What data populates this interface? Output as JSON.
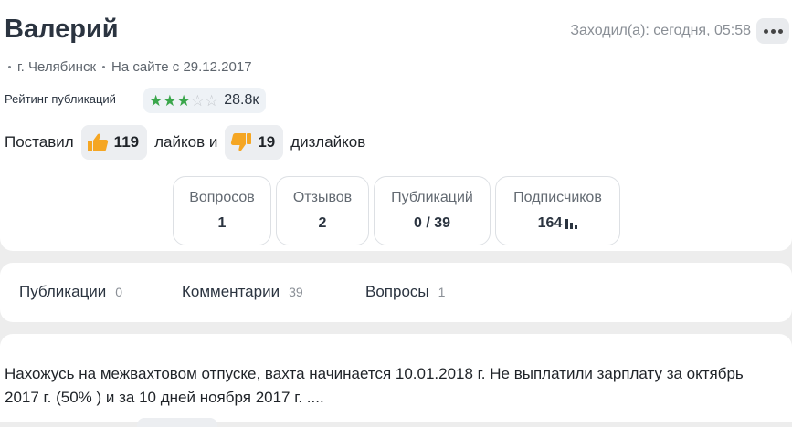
{
  "profile": {
    "name": "Валерий",
    "last_seen": "Заходил(а): сегодня, 05:58",
    "city": "г. Челябинск",
    "member_since": "На сайте с 29.12.2017"
  },
  "rating": {
    "label": "Рейтинг публикаций",
    "stars_filled": 3,
    "stars_total": 5,
    "value": "28.8к",
    "star_color": "#3aa64b"
  },
  "likes": {
    "prefix": "Поставил",
    "likes_count": "119",
    "middle": "лайков и",
    "dislikes_count": "19",
    "suffix": "дизлайков",
    "icon_color": "#f5a623"
  },
  "stats": [
    {
      "label": "Вопросов",
      "value": "1"
    },
    {
      "label": "Отзывов",
      "value": "2"
    },
    {
      "label": "Публикаций",
      "value": "0 / 39"
    },
    {
      "label": "Подписчиков",
      "value": "164"
    }
  ],
  "tabs": [
    {
      "label": "Публикации",
      "count": "0"
    },
    {
      "label": "Комментарии",
      "count": "39"
    },
    {
      "label": "Вопросы",
      "count": "1"
    }
  ],
  "post": {
    "text": "Нахожусь на межвахтовом отпуске, вахта начинается 10.01.2018 г. Не выплатили зарплату за октябрь 2017 г. (50% ) и за 10 дней ноября 2017 г. ...."
  }
}
